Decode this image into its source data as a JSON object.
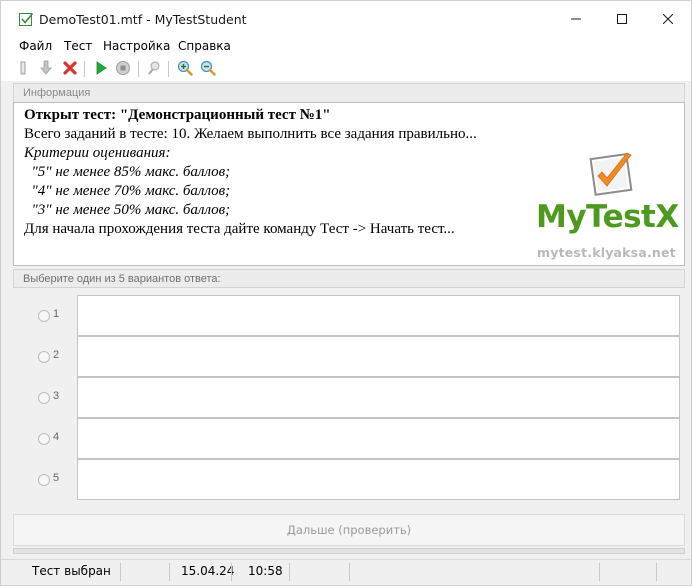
{
  "window": {
    "title": "DemoTest01.mtf - MyTestStudent",
    "app_icon": "checkbox-check-icon",
    "controls": [
      "minimize-icon",
      "maximize-icon",
      "close-icon"
    ]
  },
  "menu": {
    "items": [
      "Файл",
      "Тест",
      "Настройка",
      "Справка"
    ]
  },
  "toolbar": {
    "buttons": [
      "open-icon",
      "download-icon",
      "delete-icon",
      "play-icon",
      "stop-icon",
      "stamp-icon",
      "zoom-in-icon",
      "zoom-out-icon"
    ]
  },
  "info": {
    "header": "Информация",
    "lines": [
      "Открыт тест: \"Демонстрационный тест №1\"",
      "Всего заданий в тесте: 10. Желаем выполнить все задания правильно...",
      "Критерии оценивания:",
      "  \"5\" не менее 85% макс. баллов;",
      "  \"4\" не менее 70% макс. баллов;",
      "  \"3\" не менее 50% макс. баллов;",
      "Для начала прохождения теста дайте команду Тест -> Начать тест..."
    ],
    "logo_text": "MyTestX",
    "logo_url": "mytest.klyaksa.net"
  },
  "answers": {
    "header": "Выберите один из 5 вариантов ответа:",
    "options": [
      {
        "label": "1",
        "text": ""
      },
      {
        "label": "2",
        "text": ""
      },
      {
        "label": "3",
        "text": ""
      },
      {
        "label": "4",
        "text": ""
      },
      {
        "label": "5",
        "text": ""
      }
    ]
  },
  "next_button": {
    "label": "Дальше (проверить)"
  },
  "status": {
    "state": "Тест выбран",
    "date": "15.04.24",
    "time": "10:58"
  },
  "colors": {
    "logo_green": "#4e9a1f",
    "logo_orange": "#f08a24",
    "delete_red": "#d9352b",
    "play_green": "#22a83a"
  }
}
